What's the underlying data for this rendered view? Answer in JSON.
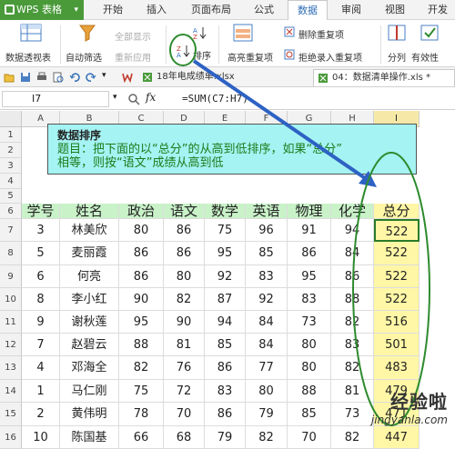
{
  "app": {
    "name": "WPS 表格"
  },
  "menu": {
    "tabs": [
      "开始",
      "插入",
      "页面布局",
      "公式",
      "数据",
      "审阅",
      "视图",
      "开发"
    ],
    "active": "数据"
  },
  "ribbon": {
    "pivot": "数据透视表",
    "autofilter": "自动筛选",
    "show_all": "全部显示",
    "reapply": "重新应用",
    "sort": "排序",
    "highlight_dup": "高亮重复项",
    "delete_dup": "删除重复项",
    "reject_dup": "拒绝录入重复项",
    "split": "分列",
    "validity": "有效性"
  },
  "doc_tabs": [
    "18年电成绩单.xlsx",
    "04：数据清单操作.xls *"
  ],
  "formula_bar": {
    "cell_ref": "I7",
    "fx": "fx",
    "formula": "=SUM(C7:H7)"
  },
  "columns": [
    "A",
    "B",
    "C",
    "D",
    "E",
    "F",
    "G",
    "H",
    "I"
  ],
  "rows": [
    "1",
    "2",
    "3",
    "4",
    "5",
    "6",
    "7",
    "8",
    "9",
    "10",
    "11",
    "12",
    "13",
    "14",
    "15",
    "16"
  ],
  "note": {
    "title": "数据排序",
    "body_line1": "题目：把下面的以“总分”的从高到低排序，如果“总分”",
    "body_line2": "相等，则按“语文”成绩从高到低"
  },
  "table": {
    "headers": [
      "学号",
      "姓名",
      "政治",
      "语文",
      "数学",
      "英语",
      "物理",
      "化学",
      "总分"
    ],
    "rows": [
      [
        "3",
        "林美欣",
        "80",
        "86",
        "75",
        "96",
        "91",
        "94",
        "522"
      ],
      [
        "5",
        "麦丽霞",
        "86",
        "86",
        "95",
        "85",
        "86",
        "84",
        "522"
      ],
      [
        "6",
        "何亮",
        "86",
        "80",
        "92",
        "83",
        "95",
        "86",
        "522"
      ],
      [
        "8",
        "李小红",
        "90",
        "82",
        "87",
        "92",
        "83",
        "88",
        "522"
      ],
      [
        "9",
        "谢秋莲",
        "95",
        "90",
        "94",
        "84",
        "73",
        "82",
        "516"
      ],
      [
        "7",
        "赵碧云",
        "88",
        "81",
        "85",
        "84",
        "80",
        "83",
        "501"
      ],
      [
        "4",
        "邓海全",
        "82",
        "76",
        "86",
        "77",
        "80",
        "82",
        "483"
      ],
      [
        "1",
        "马仁刚",
        "75",
        "72",
        "83",
        "80",
        "88",
        "81",
        "479"
      ],
      [
        "2",
        "黄伟明",
        "78",
        "70",
        "86",
        "79",
        "85",
        "73",
        "471"
      ],
      [
        "10",
        "陈国基",
        "66",
        "68",
        "79",
        "82",
        "70",
        "82",
        "447"
      ]
    ]
  },
  "watermark": {
    "line1": "经验啦",
    "line2": "jingyanla.com"
  },
  "colors": {
    "accent": "#2f6db5",
    "wps_green": "#4a9a3a",
    "header_fill": "#c9f2c9",
    "highlight_fill": "#fff7a6",
    "note_fill": "#a5f3f3",
    "annotation_green": "#2e8b2e",
    "annotation_blue": "#2d62c4"
  }
}
